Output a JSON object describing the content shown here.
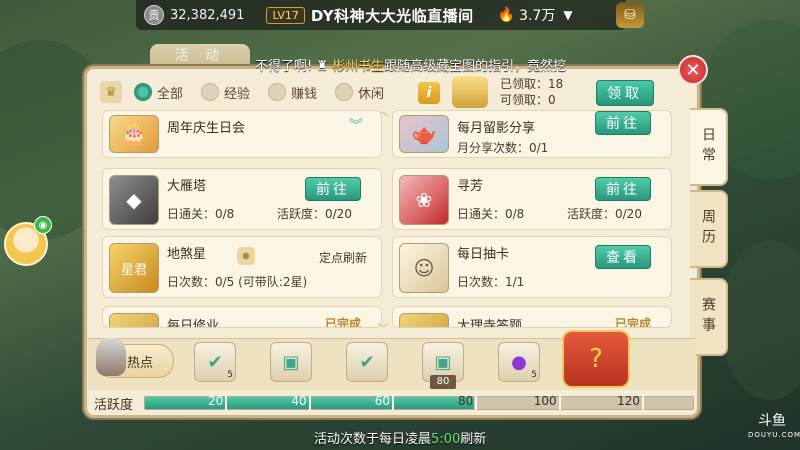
{
  "stream": {
    "coins": "32,382,491",
    "level": "LV17",
    "title": "DY科神大大光临直播间",
    "viewers": "3.7万"
  },
  "panel": {
    "title": "活 动",
    "marquee_prefix": "不得了啊!",
    "marquee_name": "彬州书生",
    "marquee_text": "跟随高级藏宝图的指引，竟然挖",
    "filters": [
      {
        "label": "全部",
        "active": true
      },
      {
        "label": "经验",
        "active": false
      },
      {
        "label": "赚钱",
        "active": false
      },
      {
        "label": "休闲",
        "active": false
      }
    ],
    "claimed": "已领取：18",
    "claimable": "可领取：0",
    "claim_button": "领取"
  },
  "activities": [
    {
      "name": "周年庆生日会",
      "sub1": "",
      "sub2": "",
      "action": ""
    },
    {
      "name": "每月留影分享",
      "sub1": "月分享次数：0/1",
      "sub2": "",
      "action": "前往"
    },
    {
      "name": "大雁塔",
      "sub1": "日通关：0/8",
      "sub2": "活跃度：0/20",
      "action": "前往"
    },
    {
      "name": "寻芳",
      "sub1": "日通关：0/8",
      "sub2": "活跃度：0/20",
      "action": "前往"
    },
    {
      "name": "地煞星",
      "sub1": "日次数：0/5 (可带队:2星)",
      "sub2": "",
      "note": "定点刷新",
      "thumb_label": "星君"
    },
    {
      "name": "每日抽卡",
      "sub1": "日次数：1/1",
      "sub2": "",
      "action": "查看"
    },
    {
      "name": "每日修业",
      "done": "已完成"
    },
    {
      "name": "大理寺答题",
      "done": "已完成"
    }
  ],
  "side_tabs": [
    "日常",
    "周历",
    "赛事"
  ],
  "hot": {
    "label": "热点",
    "rewards": [
      {
        "count": "5",
        "tag": ""
      },
      {
        "count": "",
        "tag": ""
      },
      {
        "count": "",
        "tag": ""
      },
      {
        "count": "",
        "tag": "80"
      },
      {
        "count": "5",
        "tag": ""
      }
    ]
  },
  "activity_bar": {
    "label": "活跃度",
    "value_fraction": 0.6,
    "ticks": [
      "20",
      "40",
      "60",
      "80",
      "100",
      "120"
    ]
  },
  "footer": {
    "before": "活动次数于每日凌晨",
    "time": "5:00",
    "after": "刷新"
  },
  "watermark": "斗鱼",
  "watermark_sub": "DOUYU.COM",
  "colors": {
    "accent": "#2f9f82",
    "panel_bg": "#f4ecd7",
    "close": "#d23a3a"
  }
}
